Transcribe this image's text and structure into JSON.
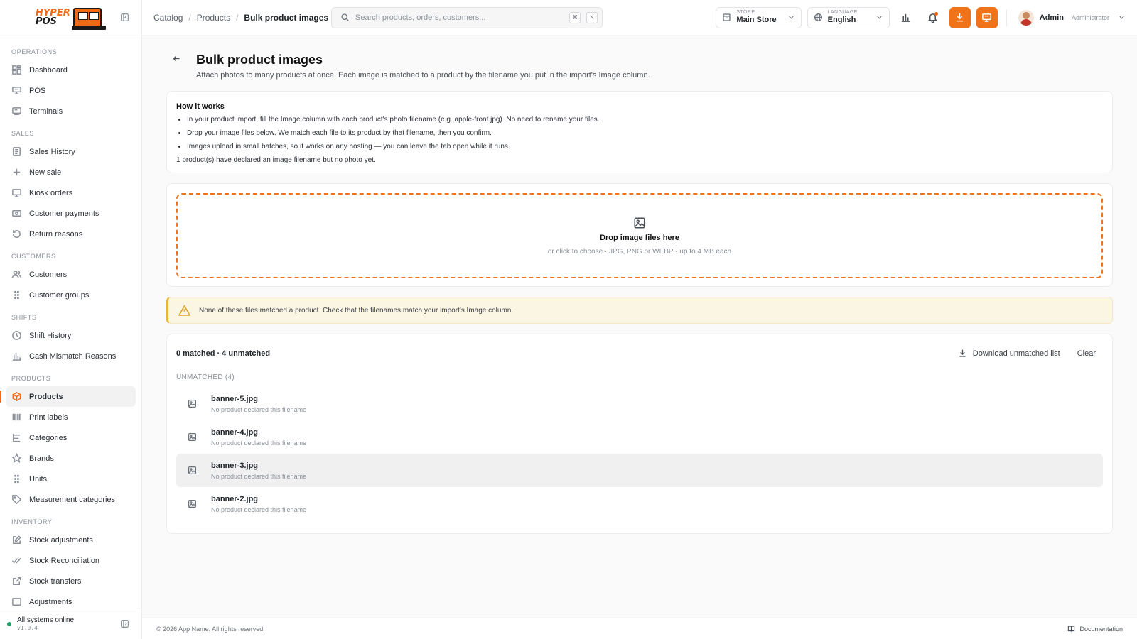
{
  "brand": {
    "logo_line1": "HYPER",
    "logo_line2": "POS",
    "accent": "#ee6a17"
  },
  "sidebar": {
    "sections": [
      {
        "title": "OPERATIONS",
        "items": [
          {
            "label": "Dashboard",
            "icon": "dashboard-icon"
          },
          {
            "label": "POS",
            "icon": "pos-icon"
          },
          {
            "label": "Terminals",
            "icon": "terminal-icon"
          }
        ]
      },
      {
        "title": "SALES",
        "items": [
          {
            "label": "Sales History",
            "icon": "receipt-icon"
          },
          {
            "label": "New sale",
            "icon": "plus-icon"
          },
          {
            "label": "Kiosk orders",
            "icon": "kiosk-icon"
          },
          {
            "label": "Customer payments",
            "icon": "payment-icon"
          },
          {
            "label": "Return reasons",
            "icon": "return-icon"
          }
        ]
      },
      {
        "title": "CUSTOMERS",
        "items": [
          {
            "label": "Customers",
            "icon": "users-icon"
          },
          {
            "label": "Customer groups",
            "icon": "grip-icon"
          }
        ]
      },
      {
        "title": "SHIFTS",
        "items": [
          {
            "label": "Shift History",
            "icon": "clock-icon"
          },
          {
            "label": "Cash Mismatch Reasons",
            "icon": "bar-chart-icon"
          }
        ]
      },
      {
        "title": "PRODUCTS",
        "items": [
          {
            "label": "Products",
            "icon": "box-icon",
            "active": true
          },
          {
            "label": "Print labels",
            "icon": "barcode-icon"
          },
          {
            "label": "Categories",
            "icon": "tree-icon"
          },
          {
            "label": "Brands",
            "icon": "star-icon"
          },
          {
            "label": "Units",
            "icon": "grip-icon"
          },
          {
            "label": "Measurement categories",
            "icon": "tag-icon"
          }
        ]
      },
      {
        "title": "INVENTORY",
        "items": [
          {
            "label": "Stock adjustments",
            "icon": "edit-icon"
          },
          {
            "label": "Stock Reconciliation",
            "icon": "check-double-icon"
          },
          {
            "label": "Stock transfers",
            "icon": "external-icon"
          },
          {
            "label": "Adjustments",
            "icon": "list-icon"
          }
        ]
      }
    ],
    "status_text": "All systems online",
    "version": "v1.0.4"
  },
  "topbar": {
    "breadcrumb": [
      "Catalog",
      "Products",
      "Bulk product images"
    ],
    "search_placeholder": "Search products, orders, customers...",
    "kbd_cmd": "⌘",
    "kbd_k": "K",
    "store_label": "STORE",
    "store_value": "Main Store",
    "language_label": "LANGUAGE",
    "language_value": "English",
    "user_name": "Admin",
    "user_role": "Administrator"
  },
  "page": {
    "title": "Bulk product images",
    "subtitle": "Attach photos to many products at once. Each image is matched to a product by the filename you put in the import's Image column."
  },
  "how_it_works": {
    "title": "How it works",
    "bullets": [
      "In your product import, fill the Image column with each product's photo filename (e.g. apple-front.jpg). No need to rename your files.",
      "Drop your image files below. We match each file to its product by that filename, then you confirm.",
      "Images upload in small batches, so it works on any hosting — you can leave the tab open while it runs."
    ],
    "note": "1 product(s) have declared an image filename but no photo yet."
  },
  "dropzone": {
    "title": "Drop image files here",
    "subtitle": "or click to choose · JPG, PNG or WEBP · up to 4 MB each"
  },
  "warning": {
    "text": "None of these files matched a product. Check that the filenames match your import's Image column."
  },
  "results": {
    "summary": "0 matched · 4 unmatched",
    "download_label": "Download unmatched list",
    "clear_label": "Clear",
    "unmatched_label": "UNMATCHED (4)",
    "files": [
      {
        "name": "banner-5.jpg",
        "note": "No product declared this filename"
      },
      {
        "name": "banner-4.jpg",
        "note": "No product declared this filename"
      },
      {
        "name": "banner-3.jpg",
        "note": "No product declared this filename"
      },
      {
        "name": "banner-2.jpg",
        "note": "No product declared this filename"
      }
    ]
  },
  "footer": {
    "copyright": "© 2026 App Name. All rights reserved.",
    "docs_label": "Documentation"
  }
}
